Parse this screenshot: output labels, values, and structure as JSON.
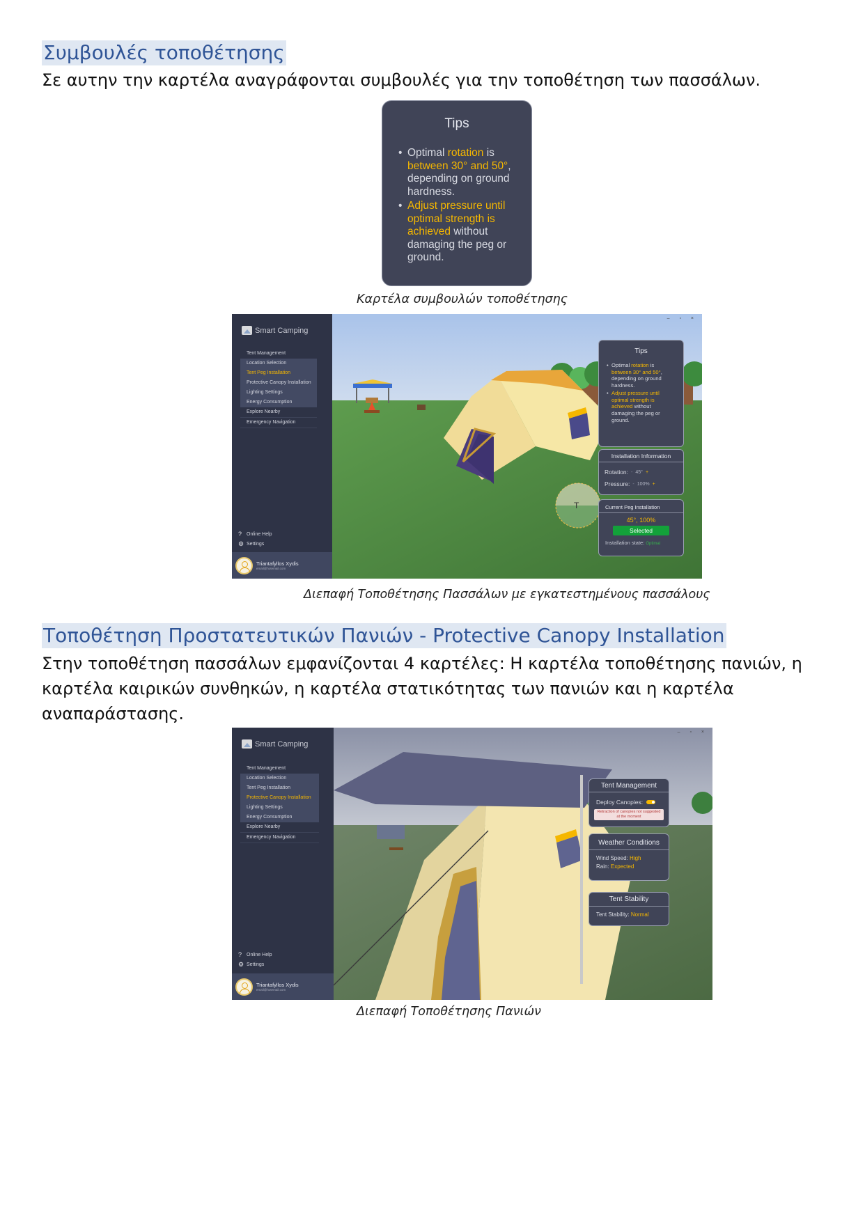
{
  "section1": {
    "heading": "Συμβουλές τοποθέτησης",
    "paragraph": "Σε αυτην την καρτέλα αναγράφονται συμβουλές για την τοποθέτηση των πασσάλων."
  },
  "tips_card": {
    "title": "Tips",
    "tip1": {
      "a": "Optimal ",
      "b": "rotation",
      "c": " is ",
      "d": "between 30° and 50°",
      "e": ", depending on ground hardness."
    },
    "tip2": {
      "a": "Adjust pressure until optimal strength is achieved",
      "b": " without damaging the peg or ground."
    }
  },
  "caption1": "Καρτέλα συμβουλών τοποθέτησης",
  "app_common": {
    "app_name": "Smart Camping",
    "nav": {
      "tent_management": "Tent Management",
      "location_selection": "Location Selection",
      "tent_peg_installation": "Tent Peg Installation",
      "protective_canopy_installation": "Protective Canopy Installation",
      "lighting_settings": "Lighting Settings",
      "energy_consumption": "Energy Consumption",
      "explore_nearby": "Explore Nearby",
      "emergency_navigation": "Emergency Navigation"
    },
    "online_help": "Online Help",
    "settings": "Settings",
    "user_name": "Triantafyllos Xydis",
    "user_email": "email@hotemail.com",
    "window_controls": "– ▫ ×",
    "help_icon": "question-icon",
    "settings_icon": "gear-icon"
  },
  "peg_screen": {
    "installation_info": {
      "title": "Installation Information",
      "rotation_label": "Rotation:",
      "rotation_value": "45°",
      "pressure_label": "Pressure:",
      "pressure_value": "100%",
      "minus": "-",
      "plus": "+"
    },
    "current_peg": {
      "title": "Current Peg Installation",
      "value": "45°, 100%",
      "button": "Selected",
      "state_label": "Installation state:",
      "state_value": "Optimal"
    },
    "peg_marker": "T"
  },
  "caption2": "Διεπαφή Τοποθέτησης Πασσάλων με εγκατεστημένους πασσάλους",
  "section2": {
    "heading": "Τοποθέτηση Προστατευτικών Πανιών - Protective Canopy Installation",
    "paragraph": "Στην τοποθέτηση πασσάλων εμφανίζονται 4 καρτέλες: Η καρτέλα τοποθέτησης πανιών, η καρτέλα καιρικών συνθηκών, η καρτέλα στατικότητας των πανιών και η καρτέλα αναπαράστασης."
  },
  "canopy_screen": {
    "tent_management": {
      "title": "Tent Management",
      "deploy_label": "Deploy Canopies:",
      "warning": "Retraction of canopies not suggested at the moment"
    },
    "weather": {
      "title": "Weather Conditions",
      "wind_label": "Wind Speed:",
      "wind_value": "High",
      "rain_label": "Rain:",
      "rain_value": "Expected"
    },
    "stability": {
      "title": "Tent Stability",
      "label": "Tent Stability:",
      "value": "Normal"
    }
  },
  "caption3": "Διεπαφή Τοποθέτησης Πανιών",
  "colors": {
    "heading": "#2f5496",
    "heading_bg": "#dfe7f2",
    "panel_bg": "#404457",
    "sidebar_bg": "#2e3346",
    "accent": "#f5b700",
    "selected_green": "#13a13a"
  }
}
